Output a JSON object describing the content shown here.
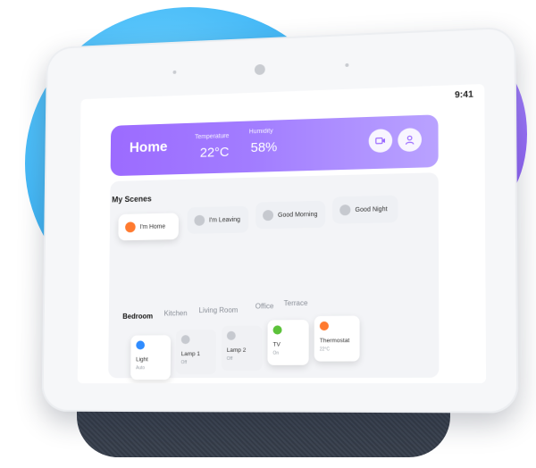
{
  "status": {
    "time": "9:41"
  },
  "header": {
    "title": "Home",
    "temperature_label": "Temperature",
    "temperature_value": "22°C",
    "humidity_label": "Humidity",
    "humidity_value": "58%"
  },
  "scenes": {
    "title": "My Scenes",
    "items": [
      {
        "label": "I'm Home",
        "icon": "home-icon",
        "active": true
      },
      {
        "label": "I'm Leaving",
        "icon": "leaving-icon",
        "active": false
      },
      {
        "label": "Good Morning",
        "icon": "sunrise-icon",
        "active": false
      },
      {
        "label": "Good Night",
        "icon": "moon-icon",
        "active": false
      }
    ]
  },
  "rooms": {
    "tabs": [
      "Bedroom",
      "Kitchen",
      "Living Room",
      "Office",
      "Terrace"
    ],
    "active_tab": "Bedroom"
  },
  "devices": [
    {
      "name": "Light",
      "state": "Auto",
      "icon": "light-icon",
      "on": true,
      "color": "#2f8cff"
    },
    {
      "name": "Lamp 1",
      "state": "Off",
      "icon": "lamp-icon",
      "on": false,
      "color": "#c6c9cf"
    },
    {
      "name": "Lamp 2",
      "state": "Off",
      "icon": "lamp-icon",
      "on": false,
      "color": "#c6c9cf"
    },
    {
      "name": "TV",
      "state": "On",
      "icon": "tv-icon",
      "on": true,
      "color": "#5cc23a"
    },
    {
      "name": "Thermostat",
      "state": "22°C",
      "icon": "thermostat-icon",
      "on": true,
      "color": "#ff7a2f"
    }
  ],
  "colors": {
    "accent": "#9c6bff",
    "blob_blue": "#42b7f6",
    "blob_purple": "#8a5cf5",
    "base": "#3a414d"
  }
}
